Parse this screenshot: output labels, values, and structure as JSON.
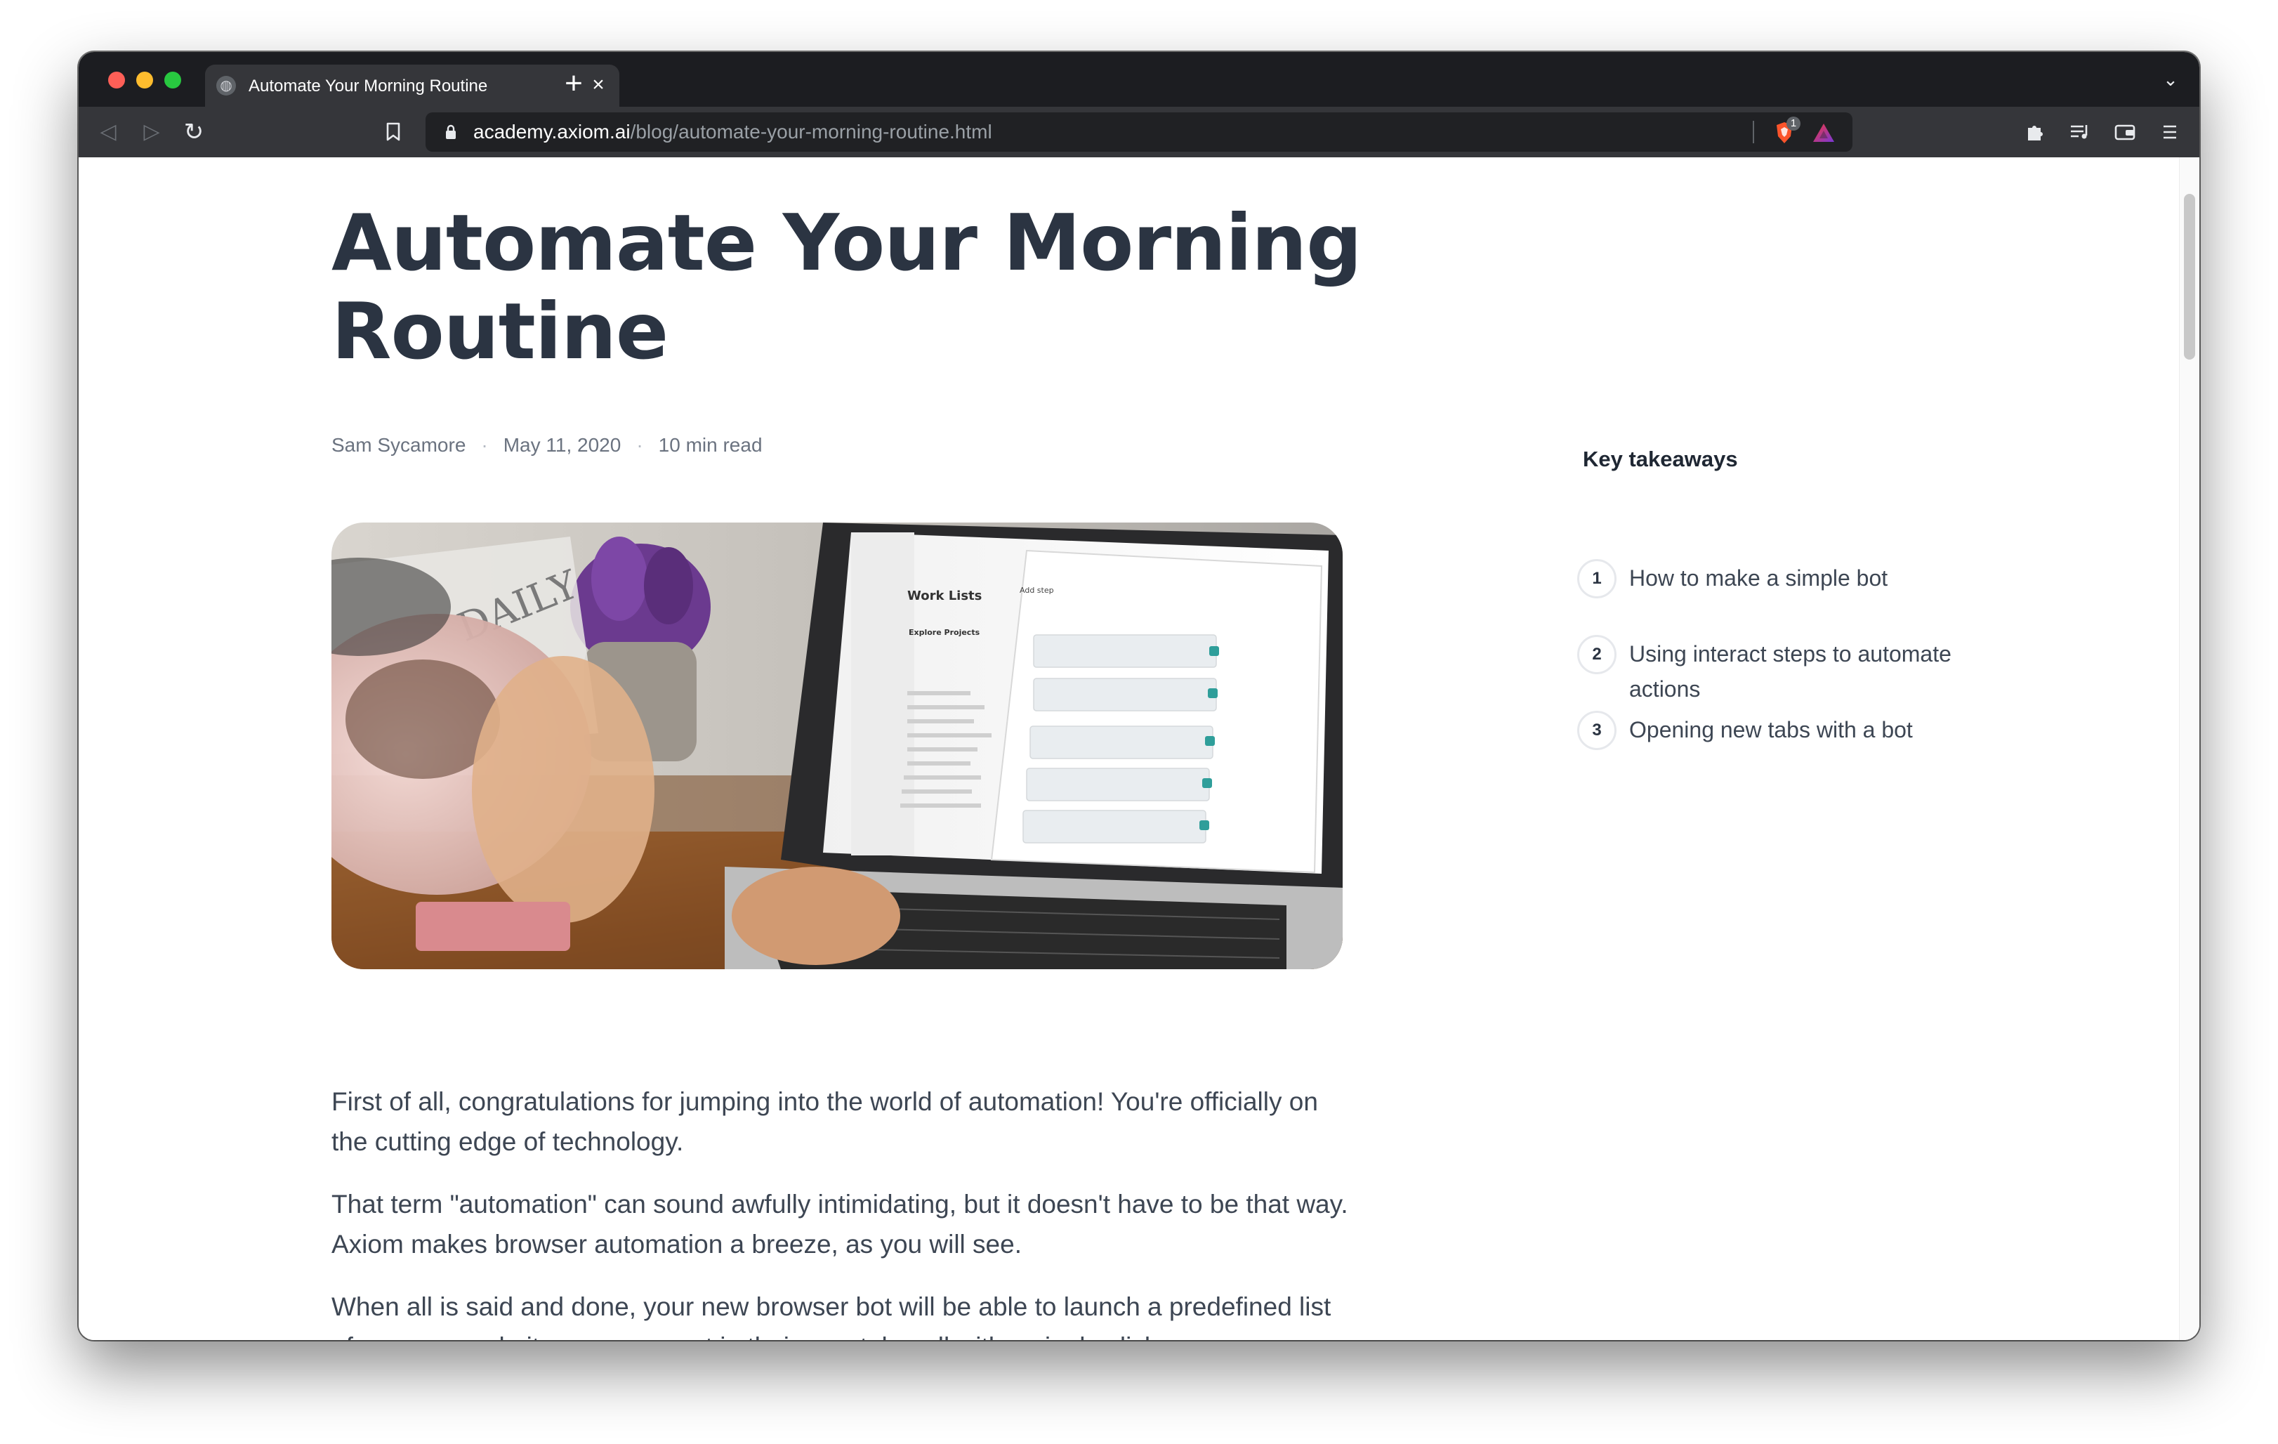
{
  "browser": {
    "tab": {
      "title": "Automate Your Morning Routine",
      "icon": "globe-icon"
    },
    "new_tab_label": "+",
    "address": {
      "host": "academy.axiom.ai",
      "path": "/blog/automate-your-morning-routine.html"
    },
    "shield_count": "1"
  },
  "article": {
    "title": "Automate Your Morning Routine",
    "author": "Sam Sycamore",
    "date": "May 11, 2020",
    "read_time": "10 min read",
    "separator": "·",
    "paragraphs": [
      "First of all, congratulations for jumping into the world of automation! You're officially on the cutting edge of technology.",
      "That term \"automation\" can sound awfully intimidating, but it doesn't have to be that way. Axiom makes browser automation a breeze, as you will see.",
      "When all is said and done, your new browser bot will be able to launch a predefined list of as many websites as you want in their own tabs, all with a single click."
    ]
  },
  "hero_image": {
    "screen_heading_1": "Work Lists",
    "screen_heading_2": "Explore Projects",
    "screen_panel_label": "Add step",
    "mug_text": "DAILY"
  },
  "sidebar": {
    "title": "Key takeaways",
    "items": [
      {
        "num": "1",
        "text": "How to make a simple bot"
      },
      {
        "num": "2",
        "text": "Using interact steps to automate actions"
      },
      {
        "num": "3",
        "text": "Opening new tabs with a bot"
      }
    ]
  },
  "colors": {
    "chrome_dark": "#1c1d21",
    "toolbar": "#35363a",
    "title_text": "#2b3442",
    "body_text": "#3d4653"
  }
}
